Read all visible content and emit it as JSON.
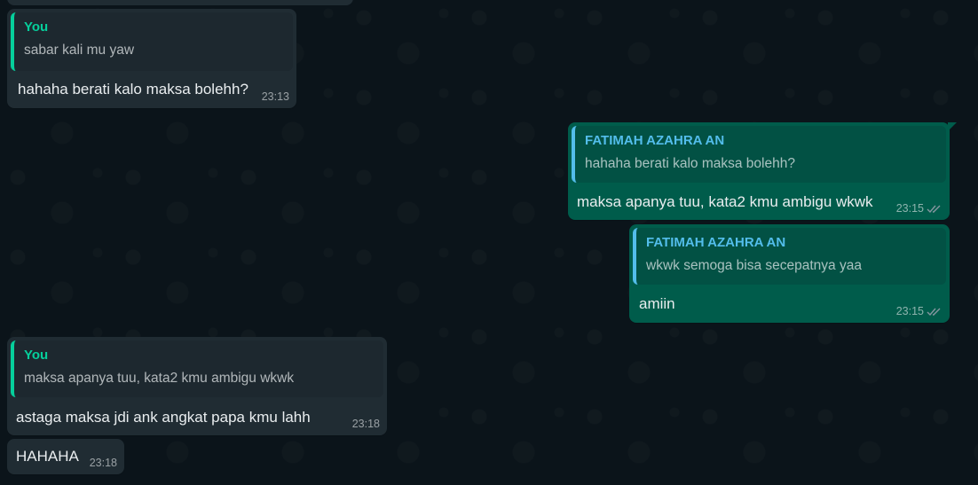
{
  "messages": [
    {
      "direction": "incoming",
      "quote": {
        "author": "You",
        "text": "sabar kali mu yaw"
      },
      "text": "hahaha berati kalo maksa bolehh?",
      "time": "23:13"
    },
    {
      "direction": "outgoing",
      "quote": {
        "author": "FATIMAH AZAHRA AN",
        "text": "hahaha berati kalo maksa bolehh?"
      },
      "text": "maksa apanya tuu, kata2 kmu ambigu wkwk",
      "time": "23:15",
      "status_icon": "double-check-icon"
    },
    {
      "direction": "outgoing",
      "quote": {
        "author": "FATIMAH AZAHRA AN",
        "text": "wkwk semoga bisa secepatnya yaa"
      },
      "text": "amiin",
      "time": "23:15",
      "status_icon": "double-check-icon"
    },
    {
      "direction": "incoming",
      "quote": {
        "author": "You",
        "text": "maksa apanya tuu, kata2 kmu ambigu wkwk"
      },
      "text": "astaga maksa jdi ank angkat papa kmu lahh",
      "time": "23:18"
    },
    {
      "direction": "incoming",
      "text": "HAHAHA",
      "time": "23:18"
    }
  ],
  "colors": {
    "background": "#0b141a",
    "incoming_bubble": "#202c33",
    "outgoing_bubble": "#005c4b",
    "quote_you_accent": "#06cf9c",
    "quote_contact_accent": "#53bdeb",
    "read_tick": "#8696a0"
  }
}
